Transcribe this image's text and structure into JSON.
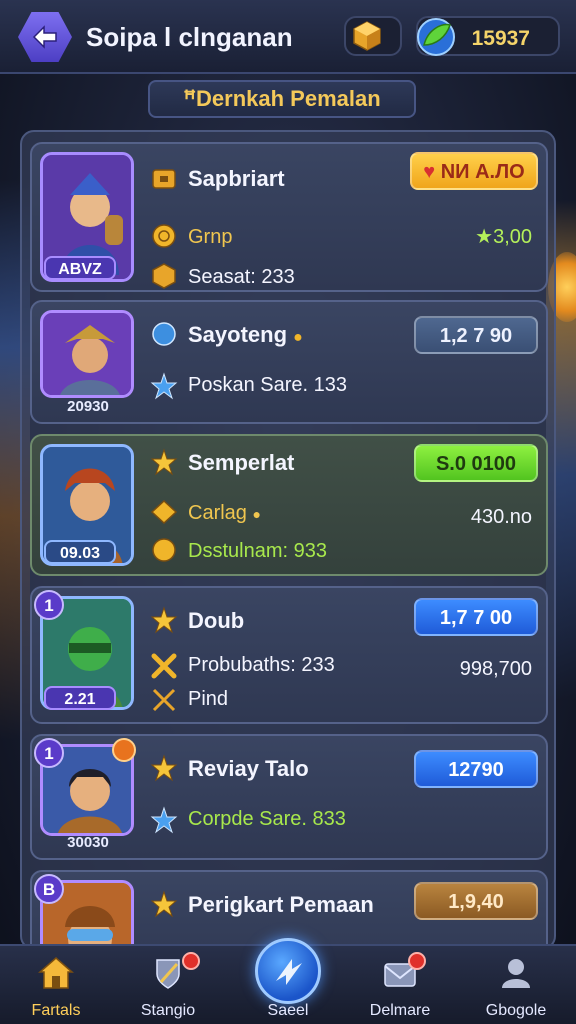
{
  "header": {
    "title": "Soipa l clnganan",
    "coins": "15937"
  },
  "section_title": "ꟸDernkah Pemalan",
  "cards": [
    {
      "portrait_badge": "ΑΒVZ",
      "name": "Sapbriart",
      "line2": "Grnp",
      "line3": "Seasat: 233",
      "button": "NИ Α.ЛО",
      "value2": "★3,00"
    },
    {
      "portrait_caption": "20930",
      "name": "Sayoteng",
      "line2": "Poskan Sare. 133",
      "button": "1,2 7 90"
    },
    {
      "portrait_badge": "09.03",
      "name": "Semperlat",
      "line2": "Carlag",
      "line3": "Dsstulnam: 933",
      "button": "S.0 0100",
      "value2": "430.no"
    },
    {
      "level": "1",
      "portrait_badge": "2.21",
      "name": "Doub",
      "line2": "Probubaths: 233",
      "line3": "Pind",
      "button": "1,7 7 00",
      "value2": "998,700"
    },
    {
      "level": "1",
      "portrait_caption": "30030",
      "name": "Reviay Talo",
      "line2": "Corpde Sare. 833",
      "button": "12790"
    },
    {
      "level": "B",
      "name": "Perigkart Pemaan",
      "button": "1,9,40"
    }
  ],
  "nav": [
    {
      "label": "Fartals"
    },
    {
      "label": "Stangio"
    },
    {
      "label": "Saeel"
    },
    {
      "label": "Delmare"
    },
    {
      "label": "Gbogole"
    }
  ],
  "colors": {
    "accent_gold": "#f0c64f",
    "button_yellow": "#f0a51b",
    "button_green": "#52c420",
    "button_blue": "#1f5bd8",
    "button_brown": "#8b5a23"
  }
}
